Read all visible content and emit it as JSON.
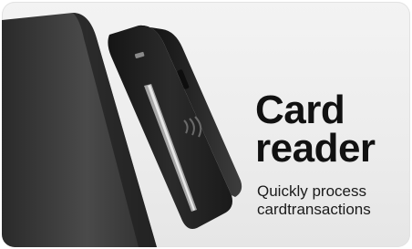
{
  "card": {
    "title_line1": "Card",
    "title_line2": "reader",
    "subtitle_line1": "Quickly process",
    "subtitle_line2": "cardtransactions",
    "image": "card-reader-device-illustration"
  },
  "colors": {
    "background": "#ececec",
    "device_dark": "#1c1c1c",
    "device_mid": "#3a3a3a",
    "text": "#111111"
  }
}
